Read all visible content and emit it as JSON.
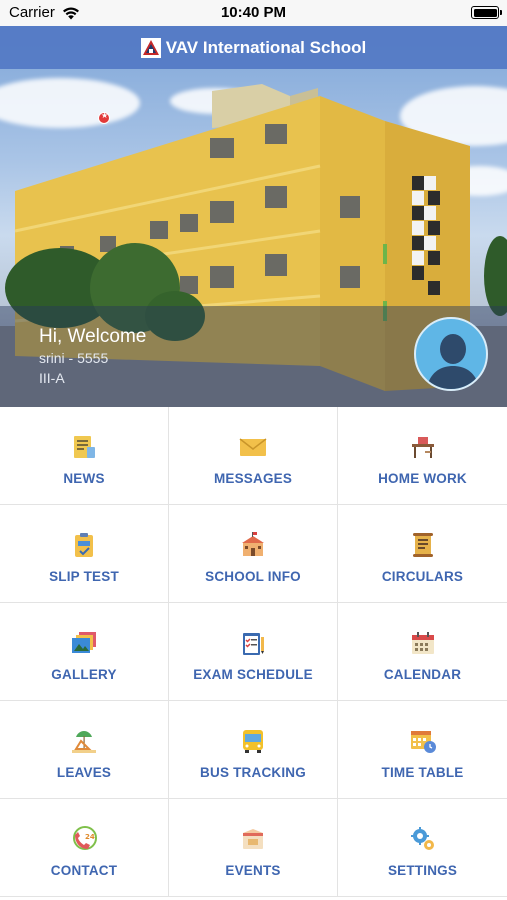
{
  "status_bar": {
    "carrier": "Carrier",
    "time": "10:40 PM"
  },
  "header": {
    "title": "VAV International School"
  },
  "profile": {
    "greeting": "Hi, Welcome",
    "student": "srini - 5555",
    "class": "III-A"
  },
  "menu": [
    {
      "label": "NEWS",
      "icon": "news-icon"
    },
    {
      "label": "MESSAGES",
      "icon": "envelope-icon"
    },
    {
      "label": "HOME WORK",
      "icon": "desk-icon"
    },
    {
      "label": "SLIP TEST",
      "icon": "clipboard-pass-icon",
      "badge": true
    },
    {
      "label": "SCHOOL INFO",
      "icon": "school-building-icon"
    },
    {
      "label": "CIRCULARS",
      "icon": "scroll-icon"
    },
    {
      "label": "GALLERY",
      "icon": "photos-icon"
    },
    {
      "label": "EXAM SCHEDULE",
      "icon": "checklist-icon"
    },
    {
      "label": "CALENDAR",
      "icon": "calendar-icon"
    },
    {
      "label": "LEAVES",
      "icon": "beach-chair-icon"
    },
    {
      "label": "BUS TRACKING",
      "icon": "bus-icon"
    },
    {
      "label": "TIME TABLE",
      "icon": "timetable-clock-icon"
    },
    {
      "label": "CONTACT",
      "icon": "phone-24-icon"
    },
    {
      "label": "EVENTS",
      "icon": "calendar-event-icon"
    },
    {
      "label": "SETTINGS",
      "icon": "gears-icon"
    }
  ],
  "colors": {
    "header": "#5278c4",
    "label": "#3f66b0",
    "building": "#e8c24e",
    "avatar": "#5fb6e6"
  }
}
